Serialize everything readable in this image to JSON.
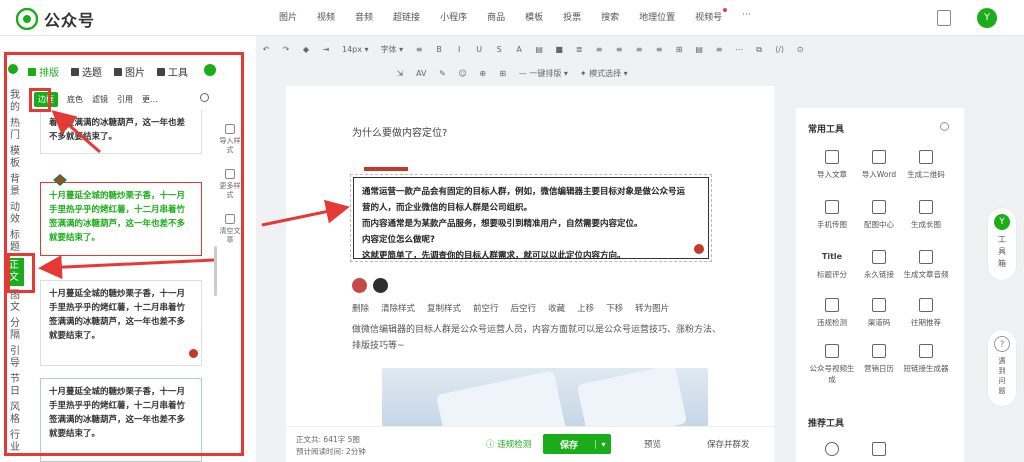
{
  "app": {
    "title": "公众号"
  },
  "topmenu": [
    "图片",
    "视频",
    "音频",
    "超链接",
    "小程序",
    "商品",
    "模板",
    "投票",
    "搜索",
    "地理位置",
    "视频号",
    "···"
  ],
  "left": {
    "tabs": [
      "排版",
      "选题",
      "图片",
      "工具"
    ],
    "categories": [
      "我的",
      "热门",
      "模板",
      "背景",
      "动效",
      "标题",
      "正文",
      "图文",
      "分隔",
      "引导",
      "节日",
      "风格",
      "行业"
    ],
    "active_category": "正文",
    "subtabs": [
      "边框",
      "底色",
      "滤镜",
      "引用",
      "更..."
    ],
    "cards": [
      {
        "text": "着竹签满满的冰糖葫芦，这一年也差不多就要结束了。"
      },
      {
        "text": "十月蔓延全城的糖炒栗子香，十一月手里热乎乎的烤红薯，十二月串着竹签满满的冰糖葫芦，这一年也差不多就要结束了。"
      },
      {
        "text": "十月蔓延全城的糖炒栗子香，十一月手里热乎乎的烤红薯，十二月串着竹签满满的冰糖葫芦，这一年也差不多就要结束了。"
      },
      {
        "text": "十月蔓延全城的糖炒栗子香，十一月手里热乎乎的烤红薯，十二月串着竹签满满的冰糖葫芦，这一年也差不多就要结束了。"
      }
    ],
    "side_tools": [
      "导入样式",
      "更多样式",
      "清空文章"
    ]
  },
  "toolbar": {
    "row1": [
      "↶",
      "↷",
      "◆",
      "⇥",
      "14px ▾",
      "字体 ▾",
      "≡",
      "B",
      "I",
      "U",
      "S",
      "A",
      "▤",
      "■",
      "≣",
      "≡",
      "≡",
      "≡",
      "≡",
      "⊞",
      "▤",
      "≡",
      "⋯",
      "⧉",
      "⟨/⟩",
      "⊙"
    ],
    "row2": [
      "⇲",
      "AV",
      "✎",
      "☺",
      "⊕",
      "⊞",
      "— 一键排版 ▾",
      "✦ 模式选择 ▾"
    ]
  },
  "editor": {
    "title": "为什么要做内容定位?",
    "quote_lines": [
      "通常运营一款产品会有固定的目标人群，例如，微信编辑器主要目标对象是做公众号运",
      "营的人，而企业微信的目标人群是公司组织。",
      "而内容通常是为某款产品服务，想要吸引到精准用户，自然需要内容定位。",
      "内容定位怎么做呢?",
      "这就更简单了，先调查你的目标人群需求，就可以以此定位内容方向。"
    ],
    "swatch_colors": [
      "#c44a4a",
      "#2f2f2f"
    ],
    "actions": [
      "删除",
      "清除样式",
      "复制样式",
      "前空行",
      "后空行",
      "收藏",
      "上移",
      "下移",
      "转为图片"
    ],
    "paragraph": "做微信编辑器的目标人群是公众号运营人员，内容方面就可以是公众号运营技巧、涨粉方法、排版技巧等~"
  },
  "footer": {
    "word_label": "正文共:",
    "word_value": "641字 5图",
    "read_label": "预计阅读时间:",
    "read_value": "2分钟",
    "check": "违规检测",
    "save": "保存",
    "preview": "预览",
    "save_send": "保存并群发"
  },
  "right": {
    "title": "常用工具",
    "tools": [
      "导入文章",
      "导入Word",
      "生成二维码",
      "手机传图",
      "配图中心",
      "生成长图",
      "标题评分",
      "永久链接",
      "生成文章音频",
      "违规检测",
      "渠道码",
      "往期推荐",
      "公众号视频生成",
      "营销日历",
      "短链接生成器"
    ],
    "title_icon": "Title",
    "title2": "推荐工具"
  },
  "float": {
    "toolbox": "工具箱",
    "feedback": "遇到问题"
  },
  "colors": {
    "accent": "#1aad19",
    "annotation": "#e53935"
  }
}
